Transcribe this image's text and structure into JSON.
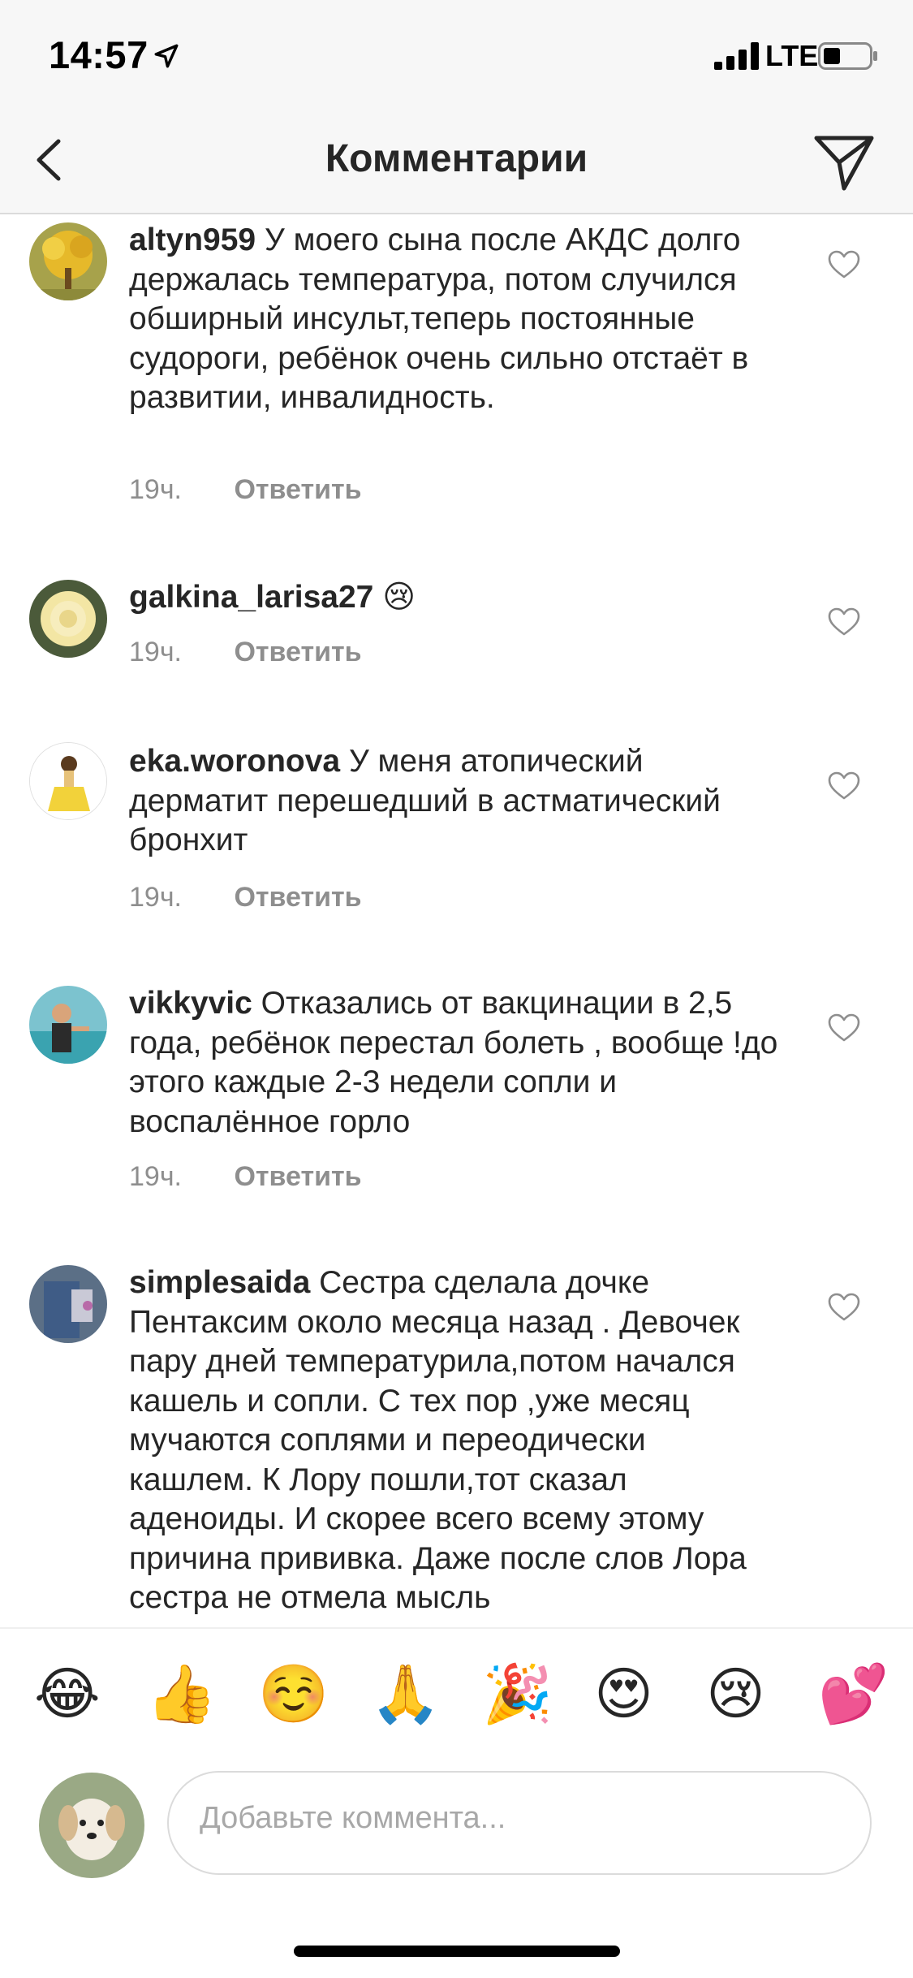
{
  "status": {
    "time": "14:57",
    "network": "LTE"
  },
  "header": {
    "title": "Комментарии",
    "icons": [
      "back-chevron-icon",
      "direct-send-icon"
    ]
  },
  "comments": [
    {
      "username": "altyn959",
      "text": "У моего сына после АКДС долго держалась температура, потом случился обширный инсульт,теперь постоянные судороги, ребёнок очень сильно отстаёт в развитии, инвалидность.",
      "time": "19ч.",
      "reply": "Ответить"
    },
    {
      "username": "galkina_larisa27",
      "text": "😢",
      "time": "19ч.",
      "reply": "Ответить"
    },
    {
      "username": "eka.woronova",
      "text": "У меня атопический дерматит перешедший в астматический бронхит",
      "time": "19ч.",
      "reply": "Ответить"
    },
    {
      "username": "vikkyvic",
      "text": "Отказались от вакцинации в 2,5 года, ребёнок перестал болеть , вообще !до этого каждые 2-3 недели сопли и воспалённое горло",
      "time": "19ч.",
      "reply": "Ответить"
    },
    {
      "username": "simplesaida",
      "text": "Сестра сделала дочке Пентаксим около месяца назад . Девочек пару дней температурила,потом начался кашель и сопли. С тех пор ,уже месяц мучаются соплями и переодически кашлем. К Лору пошли,тот сказал аденоиды. И скорее всего всему этому причина прививка. Даже после слов Лора сестра не отмела мысль",
      "time": "",
      "reply": ""
    }
  ],
  "emoji_bar": [
    "😂",
    "👍",
    "☺️",
    "🙏",
    "🎉",
    "😍",
    "😢",
    "💕"
  ],
  "composer": {
    "placeholder": "Добавьте коммента..."
  }
}
